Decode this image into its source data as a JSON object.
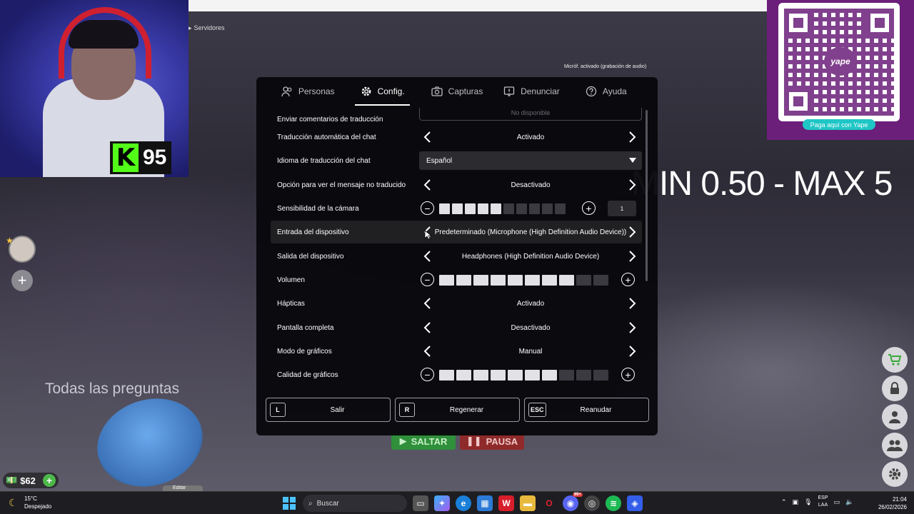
{
  "overlay": {
    "servers_label": "Servidores",
    "mic_status": "Micróf. activado (grabación de audio)",
    "stream_banner": "MIN 0.50 - MAX 5",
    "kick_viewers": "95",
    "yape_pay_label": "Paga aquí con Yape",
    "yape_logo": "yape"
  },
  "tabs": [
    {
      "label": "Personas",
      "icon": "people-icon"
    },
    {
      "label": "Config.",
      "icon": "gear-icon",
      "active": true
    },
    {
      "label": "Capturas",
      "icon": "camera-icon"
    },
    {
      "label": "Denunciar",
      "icon": "report-flag-icon"
    },
    {
      "label": "Ayuda",
      "icon": "help-icon"
    }
  ],
  "settings": {
    "translation_feedback": {
      "label": "Enviar comentarios de traducción",
      "value": "No disponible"
    },
    "chat_auto_translate": {
      "label": "Traducción automática del chat",
      "value": "Activado"
    },
    "chat_translate_language": {
      "label": "Idioma de traducción del chat",
      "value": "Español"
    },
    "show_untranslated": {
      "label": "Opción para ver el mensaje no traducido",
      "value": "Desactivado"
    },
    "camera_sensitivity": {
      "label": "Sensibilidad de la cámara",
      "value": "1",
      "filled_segments": 5,
      "total_segments": 10
    },
    "input_device": {
      "label": "Entrada del dispositivo",
      "value": "Predeterminado (Microphone (High Definition Audio Device))"
    },
    "output_device": {
      "label": "Salida del dispositivo",
      "value": "Headphones (High Definition Audio Device)"
    },
    "volume": {
      "label": "Volumen",
      "filled_segments": 8,
      "total_segments": 10
    },
    "haptics": {
      "label": "Hápticas",
      "value": "Activado"
    },
    "fullscreen": {
      "label": "Pantalla completa",
      "value": "Desactivado"
    },
    "graphics_mode": {
      "label": "Modo de gráficos",
      "value": "Manual"
    },
    "graphics_quality": {
      "label": "Calidad de gráficos",
      "filled_segments": 7,
      "total_segments": 10
    }
  },
  "footer": {
    "leave": {
      "key": "L",
      "label": "Salir"
    },
    "reset": {
      "key": "R",
      "label": "Regenerar"
    },
    "resume": {
      "key": "ESC",
      "label": "Reanudar"
    }
  },
  "game_hud": {
    "all_questions": "Todas las preguntas",
    "money": "$62",
    "jump": "SALTAR",
    "pause": "PAUSA",
    "edit": "Editar"
  },
  "taskbar": {
    "temperature": "15°C",
    "condition": "Despejado",
    "search_placeholder": "Buscar",
    "lang_top": "ESP",
    "lang_bottom": "LAA",
    "time": "21:04",
    "date": "26/02/2026",
    "discord_badge": "99+"
  },
  "colors": {
    "panel_bg": "#08080c",
    "slider_on": "#e2e2e6",
    "slider_off": "#3a3a40",
    "kick_green": "#53fc18",
    "yape_purple": "#6b1f7a"
  }
}
